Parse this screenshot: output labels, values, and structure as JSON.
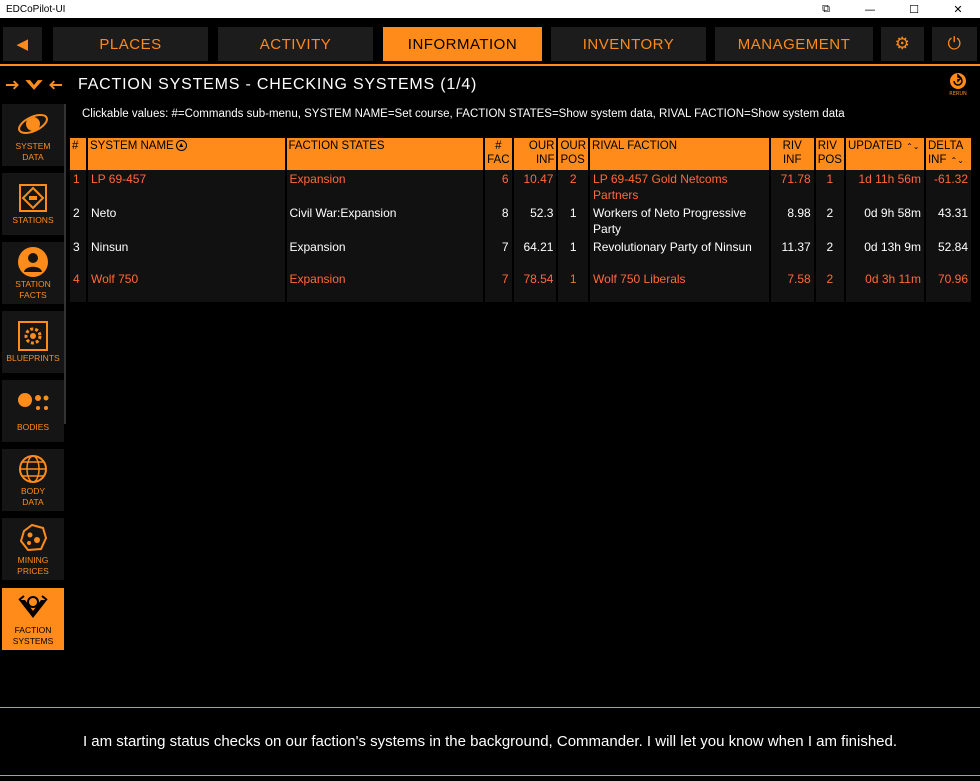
{
  "window": {
    "title": "EDCoPilot-UI",
    "controls": [
      "⧉",
      "—",
      "☐",
      "✕"
    ]
  },
  "nav": {
    "back_glyph": "◀",
    "tabs": [
      "PLACES",
      "ACTIVITY",
      "INFORMATION",
      "INVENTORY",
      "MANAGEMENT"
    ],
    "active_tab": "INFORMATION",
    "settings_glyph": "⚙",
    "power_glyph": "⏻"
  },
  "header": {
    "title": "FACTION SYSTEMS - CHECKING SYSTEMS (1/4)",
    "rerun_label": "RERUN",
    "rerun_glyph": "↻"
  },
  "hint": "Clickable values: #=Commands sub-menu, SYSTEM NAME=Set course, FACTION STATES=Show system data, RIVAL FACTION=Show system data",
  "sidebar": {
    "items": [
      {
        "label1": "SYSTEM",
        "label2": "DATA",
        "icon": "system-data-icon"
      },
      {
        "label1": "STATIONS",
        "label2": "",
        "icon": "stations-icon"
      },
      {
        "label1": "STATION",
        "label2": "FACTS",
        "icon": "station-facts-icon"
      },
      {
        "label1": "BLUEPRINTS",
        "label2": "",
        "icon": "blueprints-icon"
      },
      {
        "label1": "BODIES",
        "label2": "",
        "icon": "bodies-icon"
      },
      {
        "label1": "BODY",
        "label2": "DATA",
        "icon": "body-data-icon"
      },
      {
        "label1": "MINING",
        "label2": "PRICES",
        "icon": "mining-prices-icon"
      },
      {
        "label1": "FACTION",
        "label2": "SYSTEMS",
        "icon": "faction-systems-icon"
      }
    ],
    "active_index": 7
  },
  "table": {
    "headers": {
      "num": "#",
      "system": "SYSTEM NAME",
      "states": "FACTION STATES",
      "fac1": "#",
      "fac2": "FAC",
      "ourinf1": "OUR",
      "ourinf2": "INF",
      "ourpos1": "OUR",
      "ourpos2": "POS",
      "rival": "RIVAL FACTION",
      "rivinf1": "RIV",
      "rivinf2": "INF",
      "rivpos1": "RIV",
      "rivpos2": "POS",
      "updated": "UPDATED",
      "delta1": "DELTA",
      "delta2": "INF"
    },
    "rows": [
      {
        "num": "1",
        "system": "LP 69-457",
        "states": "Expansion",
        "fac": "6",
        "our_inf": "10.47",
        "our_pos": "2",
        "rival": "LP 69-457 Gold Netcoms Partners",
        "riv_inf": "71.78",
        "riv_pos": "1",
        "updated": "1d 11h 56m",
        "delta": "-61.32",
        "highlight": true
      },
      {
        "num": "2",
        "system": "Neto",
        "states": "Civil War:Expansion",
        "fac": "8",
        "our_inf": "52.3",
        "our_pos": "1",
        "rival": "Workers of Neto Progressive Party",
        "riv_inf": "8.98",
        "riv_pos": "2",
        "updated": "0d 9h 58m",
        "delta": "43.31",
        "highlight": false
      },
      {
        "num": "3",
        "system": "Ninsun",
        "states": "Expansion",
        "fac": "7",
        "our_inf": "64.21",
        "our_pos": "1",
        "rival": "Revolutionary Party of Ninsun",
        "riv_inf": "11.37",
        "riv_pos": "2",
        "updated": "0d 13h 9m",
        "delta": "52.84",
        "highlight": false
      },
      {
        "num": "4",
        "system": "Wolf 750",
        "states": "Expansion",
        "fac": "7",
        "our_inf": "78.54",
        "our_pos": "1",
        "rival": "Wolf 750 Liberals",
        "riv_inf": "7.58",
        "riv_pos": "2",
        "updated": "0d 3h 11m",
        "delta": "70.96",
        "highlight": true
      }
    ]
  },
  "footer": {
    "message": "I am starting status checks on our faction's systems in the background, Commander. I will let you know when I am finished."
  },
  "colors": {
    "accent": "#ff8c1a",
    "highlight_text": "#ff6a3a",
    "background": "#000000"
  }
}
